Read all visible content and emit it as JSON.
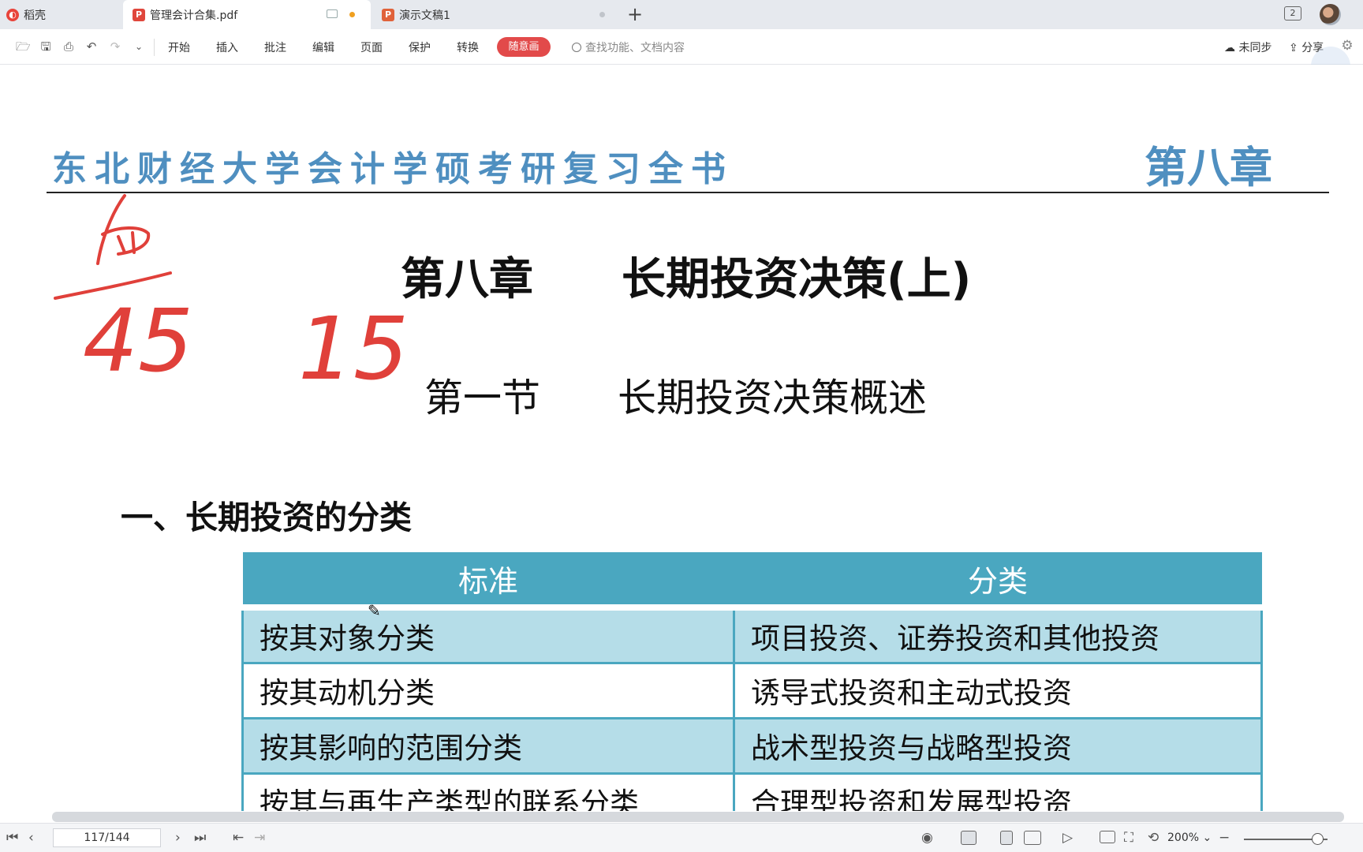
{
  "tabs": {
    "daoke": "稻壳",
    "pdf": "管理会计合集.pdf",
    "ppt": "演示文稿1",
    "tab_count": "2"
  },
  "toolbar": {
    "menus": [
      "开始",
      "插入",
      "批注",
      "编辑",
      "页面",
      "保护",
      "转换"
    ],
    "doodle": "随意画",
    "search_placeholder": "查找功能、文档内容",
    "sync": "未同步",
    "share": "分享"
  },
  "document": {
    "book_title": "东北财经大学会计学硕考研复习全书",
    "chapter_tag": "第八章",
    "chapter_heading": "第八章　　长期投资决策(上)",
    "section_heading": "第一节　　长期投资决策概述",
    "part_heading": "一、长期投资的分类",
    "table": {
      "headers": [
        "标准",
        "分类"
      ],
      "rows": [
        [
          "按其对象分类",
          "项目投资、证券投资和其他投资"
        ],
        [
          "按其动机分类",
          "诱导式投资和主动式投资"
        ],
        [
          "按其影响的范围分类",
          "战术型投资与战略型投资"
        ],
        [
          "按其与再生产类型的联系分类",
          "合理型投资和发展型投资"
        ]
      ]
    },
    "handwriting": [
      "45",
      "15"
    ]
  },
  "status": {
    "page": "117/144",
    "zoom": "200%"
  },
  "colors": {
    "accent": "#e24a4a",
    "header_blue": "#4f8fc0",
    "table_header": "#4aa7c0",
    "table_stripe": "#b5dde8",
    "handwriting": "#e0403a"
  }
}
